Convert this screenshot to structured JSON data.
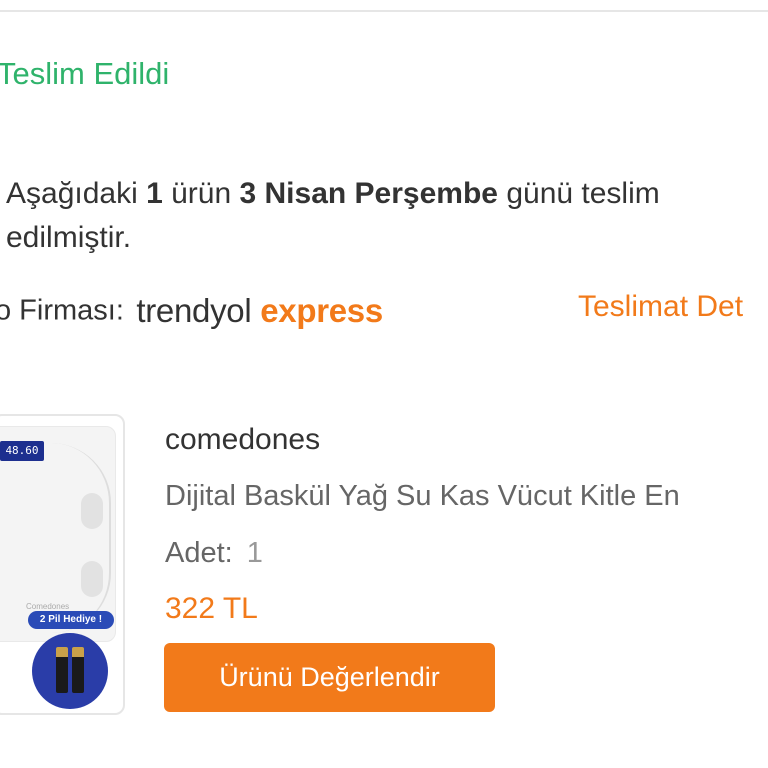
{
  "order": {
    "status": "Teslim Edildi",
    "message": {
      "prefix": "Aşağıdaki ",
      "count": "1",
      "middle": " ürün ",
      "date": "3 Nisan Perşembe",
      "suffix": " günü teslim edilmiştir."
    },
    "carrier_label": "o Firması:",
    "carrier_logo": {
      "part1": "trendyol",
      "part2": "express"
    },
    "details_link": "Teslimat Det"
  },
  "product": {
    "seller": "comedones",
    "name": "Dijital Baskül Yağ Su Kas Vücut Kitle En",
    "quantity_label": "Adet:",
    "quantity": "1",
    "price": "322 TL",
    "review_button": "Ürünü Değerlendir",
    "image": {
      "display_reading": "48.60",
      "brand_text": "Comedones",
      "badge": "2 Pil Hediye"
    }
  },
  "colors": {
    "status_green": "#2fb36b",
    "accent_orange": "#f27a1a",
    "text_dark": "#333333",
    "text_gray": "#666666",
    "badge_blue": "#2a4bb7"
  }
}
